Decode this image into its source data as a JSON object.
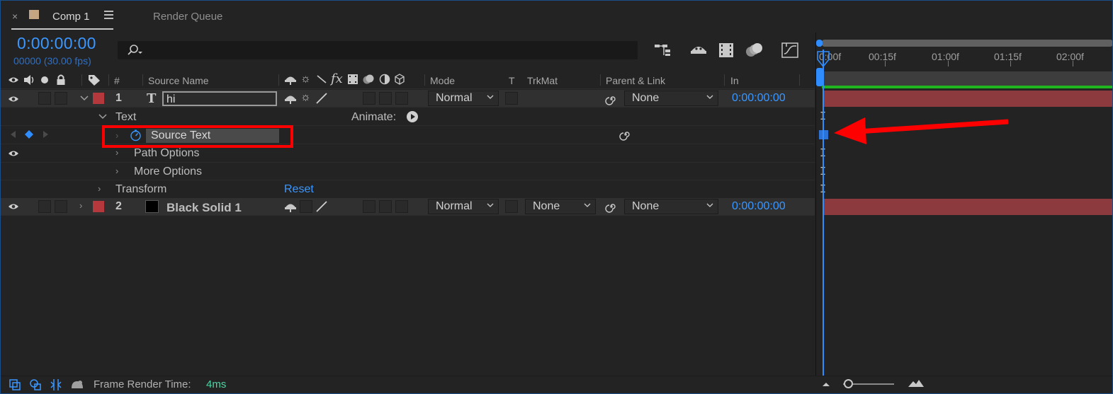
{
  "tabs": {
    "close_symbol": "×",
    "comp_tab_label": "Comp 1",
    "render_queue_label": "Render Queue"
  },
  "time": {
    "timecode": "0:00:00:00",
    "frame_info": "00000 (30.00 fps)"
  },
  "search": {
    "placeholder": ""
  },
  "columns": {
    "number": "#",
    "source_name": "Source Name",
    "fx": "fx",
    "mode": "Mode",
    "t": "T",
    "trkmat": "TrkMat",
    "parent_link": "Parent & Link",
    "in": "In"
  },
  "layers": [
    {
      "number": "1",
      "type_glyph": "T",
      "name": "hi",
      "mode": "Normal",
      "parent": "None",
      "in": "0:00:00:00",
      "label_color": "#b5393c"
    },
    {
      "number": "2",
      "name": "Black Solid 1",
      "mode": "Normal",
      "trkmat": "None",
      "parent": "None",
      "in": "0:00:00:00",
      "label_color": "#b5393c"
    }
  ],
  "properties": {
    "text_group": "Text",
    "animate_label": "Animate:",
    "source_text": "Source Text",
    "path_options": "Path Options",
    "more_options": "More Options",
    "transform": "Transform",
    "reset": "Reset"
  },
  "timeline": {
    "ticks": [
      "0:00f",
      "00:15f",
      "01:00f",
      "01:15f",
      "02:00f"
    ]
  },
  "footer": {
    "render_time_label": "Frame Render Time:",
    "render_time_value": "4ms"
  },
  "colors": {
    "accent_blue": "#3a97ff",
    "highlight_red": "#ff0000",
    "layer_bar": "#8c3a3d",
    "green": "#1fb51f"
  },
  "icons": [
    "eye-icon",
    "speaker-icon",
    "solo-icon",
    "lock-icon",
    "label-tag-icon",
    "search-icon",
    "flowchart-icon",
    "shy-icon",
    "frame-blend-icon",
    "motion-blur-icon",
    "graph-editor-icon",
    "stopwatch-icon",
    "pickwhip-icon",
    "play-circle-icon"
  ]
}
